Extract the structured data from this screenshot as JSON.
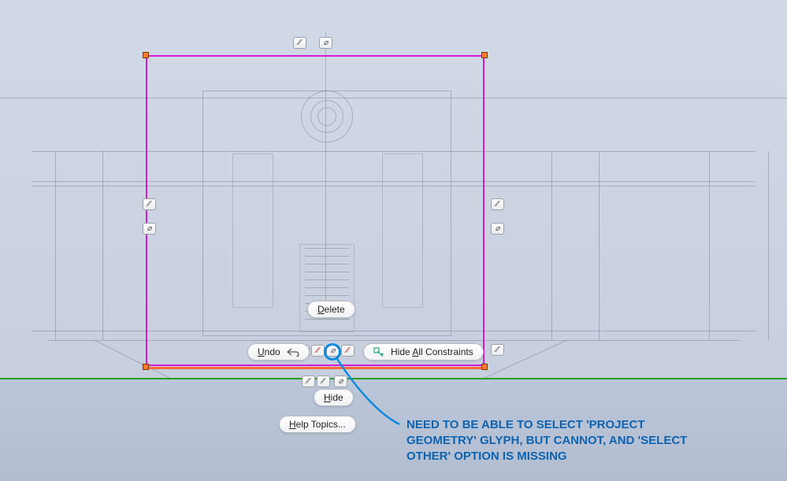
{
  "menu": {
    "delete_label": "Delete",
    "undo_label": "Undo",
    "hide_all_label": "Hide All Constraints",
    "hide_label": "Hide",
    "help_label": "Help Topics..."
  },
  "underline": {
    "delete": "D",
    "undo": "U",
    "hide_all_a": "A",
    "hide": "H",
    "help_h": "H"
  },
  "annotation": {
    "text": "NEED TO BE ABLE TO SELECT 'PROJECT GEOMETRY' GLYPH, BUT CANNOT, AND 'SELECT OTHER' OPTION IS MISSING"
  },
  "glyphs": {
    "coincident": "⁄⁄",
    "project": "⌀",
    "horizontal": "—"
  },
  "colors": {
    "accent": "#0d8adf",
    "sketch": "#d41ad4",
    "bottom_edge": "#ff6a3a",
    "ground": "#25a017",
    "note": "#0d63b0"
  }
}
